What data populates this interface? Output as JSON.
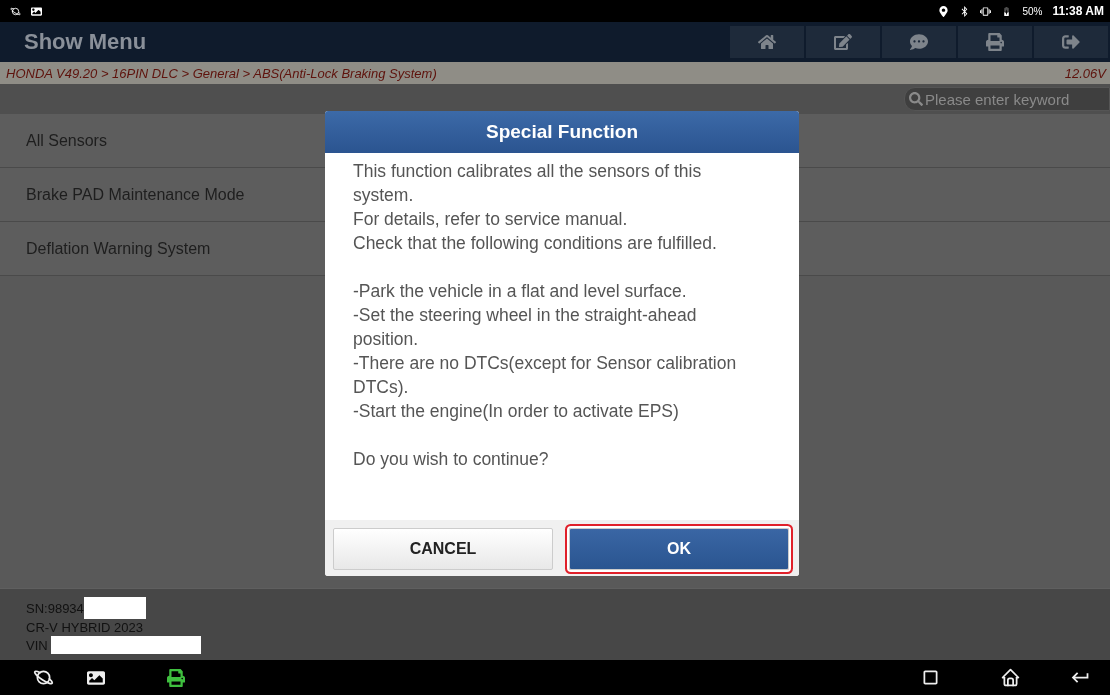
{
  "status_bar": {
    "battery": "50%",
    "time": "11:38 AM"
  },
  "header": {
    "title": "Show Menu"
  },
  "breadcrumb": {
    "path": "HONDA V49.20 > 16PIN DLC > General > ABS(Anti-Lock Braking System)",
    "voltage": "12.06V"
  },
  "search": {
    "placeholder": "Please enter keyword"
  },
  "menu_items": [
    "All Sensors",
    "Brake PAD Maintenance Mode",
    "Deflation Warning System"
  ],
  "footer": {
    "serial": "SN:98934",
    "vehicle": "CR-V HYBRID 2023",
    "vin": "VIN"
  },
  "dialog": {
    "title": "Special Function",
    "paragraphs": [
      [
        "This function calibrates all the sensors of this system.",
        "For details, refer to service manual.",
        "Check that the following conditions are fulfilled."
      ],
      [
        "-Park the vehicle in a flat and level surface.",
        "-Set the steering wheel in the straight-ahead position.",
        "-There are no DTCs(except for Sensor calibration DTCs).",
        "-Start the engine(In order to activate EPS)"
      ],
      [
        "Do you wish to continue?"
      ]
    ],
    "buttons": [
      {
        "label": "CANCEL",
        "kind": "secondary",
        "highlighted": false
      },
      {
        "label": "OK",
        "kind": "primary",
        "highlighted": true
      }
    ]
  }
}
